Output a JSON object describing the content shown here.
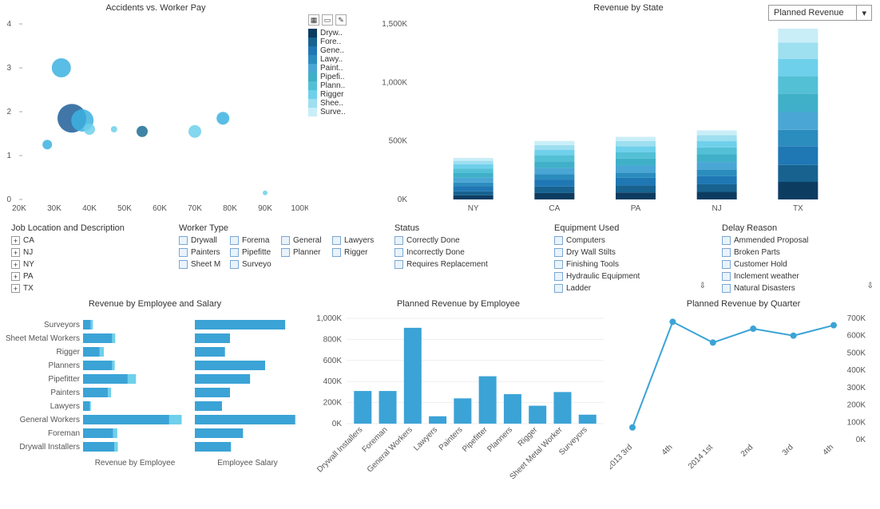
{
  "dropdown": {
    "selected": "Planned Revenue"
  },
  "chart_data": [
    {
      "id": "accidents_vs_pay",
      "type": "scatter",
      "title": "Accidents vs. Worker Pay",
      "xlabel": "",
      "ylabel": "",
      "xlim": [
        20000,
        100000
      ],
      "ylim": [
        0,
        4
      ],
      "xticks": [
        "20K",
        "30K",
        "40K",
        "50K",
        "60K",
        "70K",
        "80K",
        "90K",
        "100K"
      ],
      "yticks": [
        0,
        1,
        2,
        3,
        4
      ],
      "points": [
        {
          "x": 28000,
          "y": 1.25,
          "r": 6,
          "c": "#3db1e0"
        },
        {
          "x": 32000,
          "y": 3.0,
          "r": 12,
          "c": "#3db1e0"
        },
        {
          "x": 35000,
          "y": 1.85,
          "r": 18,
          "c": "#1f5f99"
        },
        {
          "x": 38000,
          "y": 1.8,
          "r": 14,
          "c": "#3db1e0"
        },
        {
          "x": 40000,
          "y": 1.6,
          "r": 7,
          "c": "#6fd0eb"
        },
        {
          "x": 47000,
          "y": 1.6,
          "r": 4,
          "c": "#6fd0eb"
        },
        {
          "x": 55000,
          "y": 1.55,
          "r": 7,
          "c": "#1d6f96"
        },
        {
          "x": 70000,
          "y": 1.55,
          "r": 8,
          "c": "#6fd0eb"
        },
        {
          "x": 78000,
          "y": 1.85,
          "r": 8,
          "c": "#3db1e0"
        },
        {
          "x": 90000,
          "y": 0.15,
          "r": 3,
          "c": "#6fd0eb"
        }
      ]
    },
    {
      "id": "revenue_by_state",
      "type": "bar",
      "title": "Revenue by State",
      "stacked": true,
      "ylabel": "",
      "ylim": [
        0,
        1500000
      ],
      "yticks": [
        "0K",
        "500K",
        "1,000K",
        "1,500K"
      ],
      "categories": [
        "NY",
        "CA",
        "PA",
        "NJ",
        "TX"
      ],
      "legend": [
        "Dryw..",
        "Fore..",
        "Gene..",
        "Lawy..",
        "Paint..",
        "Pipefi..",
        "Plann..",
        "Rigger",
        "Shee..",
        "Surve.."
      ],
      "colors": [
        "#0d3c61",
        "#17628f",
        "#1f77b4",
        "#2b8cbe",
        "#4aa6d4",
        "#3fb0c8",
        "#53c0d6",
        "#6fd0eb",
        "#9edff0",
        "#c9eef8"
      ],
      "series_values": {
        "NY": [
          35,
          35,
          45,
          30,
          40,
          40,
          40,
          35,
          30,
          25
        ],
        "CA": [
          55,
          55,
          60,
          45,
          55,
          55,
          55,
          45,
          40,
          35
        ],
        "PA": [
          60,
          60,
          65,
          45,
          60,
          60,
          55,
          50,
          45,
          35
        ],
        "NJ": [
          65,
          65,
          70,
          55,
          65,
          65,
          60,
          55,
          50,
          40
        ],
        "TX": [
          150,
          145,
          160,
          140,
          155,
          155,
          150,
          145,
          140,
          120
        ]
      }
    },
    {
      "id": "revenue_by_employee_salary",
      "type": "bar",
      "orientation": "horizontal",
      "title": "Revenue by Employee and Salary",
      "categories": [
        "Surveyors",
        "Sheet Metal Workers",
        "Rigger",
        "Planners",
        "Pipefitter",
        "Painters",
        "Lawyers",
        "General Workers",
        "Foreman",
        "Drywall Installers"
      ],
      "subplots": [
        "Revenue by Employee",
        "Employee Salary"
      ],
      "series": [
        {
          "name": "Revenue by Employee",
          "values": {
            "Surveyors": [
              75,
              20
            ],
            "Sheet Metal Workers": [
              280,
              30
            ],
            "Rigger": [
              160,
              40
            ],
            "Planners": [
              280,
              25
            ],
            "Pipefitter": [
              430,
              80
            ],
            "Painters": [
              240,
              30
            ],
            "Lawyers": [
              65,
              10
            ],
            "General Workers": [
              830,
              120
            ],
            "Foreman": [
              290,
              40
            ],
            "Drywall Installers": [
              300,
              35
            ]
          }
        },
        {
          "name": "Employee Salary",
          "values": {
            "Surveyors": 900,
            "Sheet Metal Workers": 350,
            "Rigger": 300,
            "Planners": 700,
            "Pipefitter": 550,
            "Painters": 350,
            "Lawyers": 270,
            "General Workers": 1000,
            "Foreman": 480,
            "Drywall Installers": 360
          }
        }
      ]
    },
    {
      "id": "planned_rev_by_employee",
      "type": "bar",
      "title": "Planned Revenue by Employee",
      "ylim": [
        0,
        1000000
      ],
      "yticks": [
        "0K",
        "200K",
        "400K",
        "600K",
        "800K",
        "1,000K"
      ],
      "categories": [
        "Drywall Installers",
        "Foreman",
        "General Workers",
        "Lawyers",
        "Painters",
        "Pipefitter",
        "Planners",
        "Rigger",
        "Sheet Metal Worker",
        "Surveyors"
      ],
      "values": [
        310,
        310,
        910,
        70,
        240,
        450,
        280,
        170,
        300,
        85
      ]
    },
    {
      "id": "planned_rev_by_quarter",
      "type": "line",
      "title": "Planned Revenue by Quarter",
      "ylim": [
        0,
        700000
      ],
      "yticks": [
        "0K",
        "100K",
        "200K",
        "300K",
        "400K",
        "500K",
        "600K",
        "700K"
      ],
      "x": [
        "2013 3rd",
        "4th",
        "2014 1st",
        "2nd",
        "3rd",
        "4th"
      ],
      "values": [
        70,
        680,
        560,
        640,
        600,
        660
      ]
    }
  ],
  "filters": {
    "job_location": {
      "title": "Job Location and Description",
      "items": [
        "CA",
        "NJ",
        "NY",
        "PA",
        "TX"
      ]
    },
    "worker_type": {
      "title": "Worker Type",
      "items": [
        "Drywall",
        "Forema",
        "General",
        "Lawyers",
        "Painters",
        "Pipefitte",
        "Planner",
        "Rigger",
        "Sheet M",
        "Surveyo"
      ]
    },
    "status": {
      "title": "Status",
      "items": [
        "Correctly Done",
        "Incorrectly Done",
        "Requires Replacement"
      ]
    },
    "equipment": {
      "title": "Equipment Used",
      "items": [
        "Computers",
        "Dry Wall Stilts",
        "Finishing Tools",
        "Hydraulic Equipment",
        "Ladder"
      ]
    },
    "delay": {
      "title": "Delay Reason",
      "items": [
        "Ammended Proposal",
        "Broken Parts",
        "Customer Hold",
        "Inclement weather",
        "Natural Disasters"
      ]
    }
  },
  "legend_toolbar": [
    "grid",
    "box",
    "pencil"
  ]
}
